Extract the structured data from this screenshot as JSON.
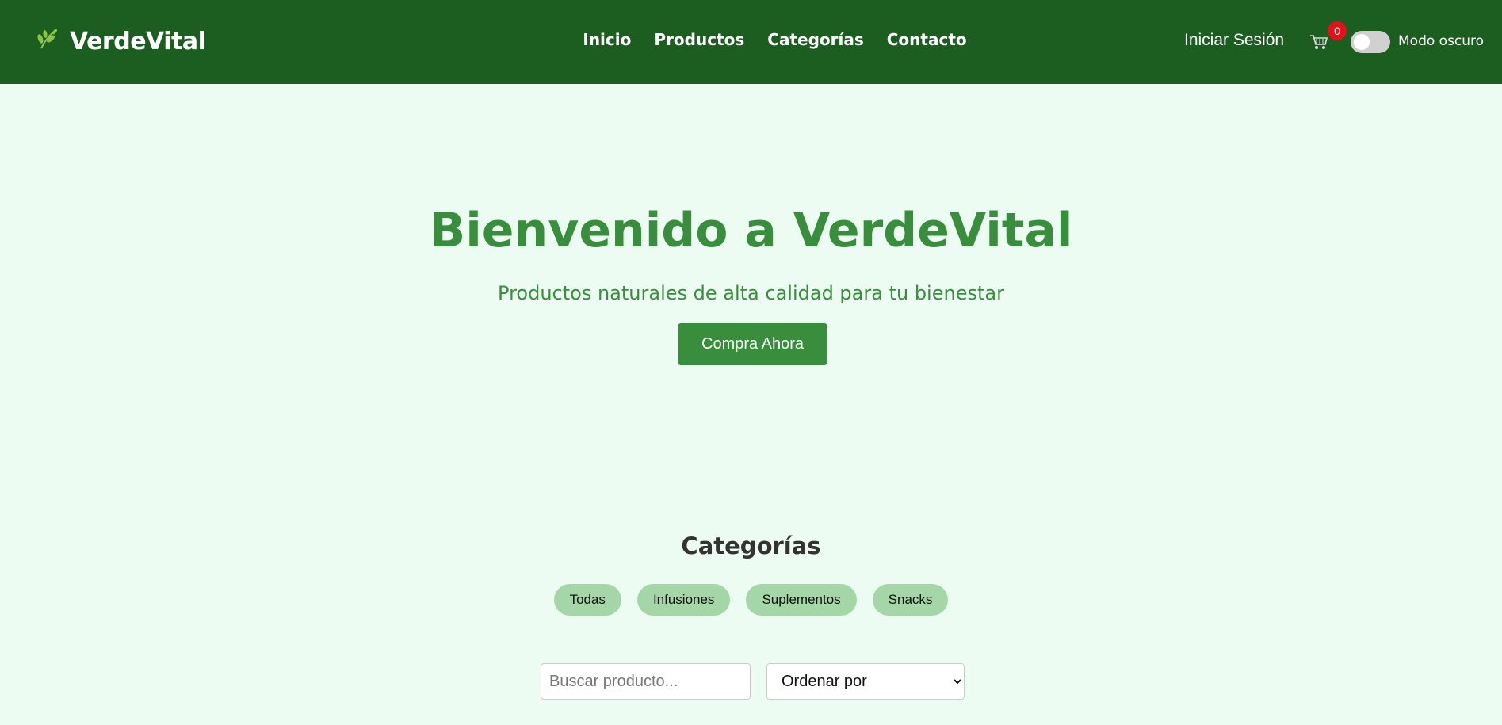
{
  "brand": {
    "name": "VerdeVital",
    "icon": "leaf-icon",
    "icon_color": "#8bc34a"
  },
  "nav": {
    "links": [
      "Inicio",
      "Productos",
      "Categorías",
      "Contacto"
    ]
  },
  "header": {
    "login_label": "Iniciar Sesión",
    "cart_icon": "cart-icon",
    "cart_count": "0",
    "dark_mode_label": "Modo oscuro"
  },
  "hero": {
    "title": "Bienvenido a VerdeVital",
    "subtitle": "Productos naturales de alta calidad para tu bienestar",
    "cta_label": "Compra Ahora"
  },
  "categories": {
    "title": "Categorías",
    "items": [
      "Todas",
      "Infusiones",
      "Suplementos",
      "Snacks"
    ]
  },
  "filters": {
    "search_placeholder": "Buscar producto...",
    "sort_selected": "Ordenar por"
  },
  "colors": {
    "header_bg": "#1c5e20",
    "page_bg": "#edfcf2",
    "accent": "#388e3c",
    "chip_bg": "#a5d6a7",
    "badge": "#e3121a"
  }
}
